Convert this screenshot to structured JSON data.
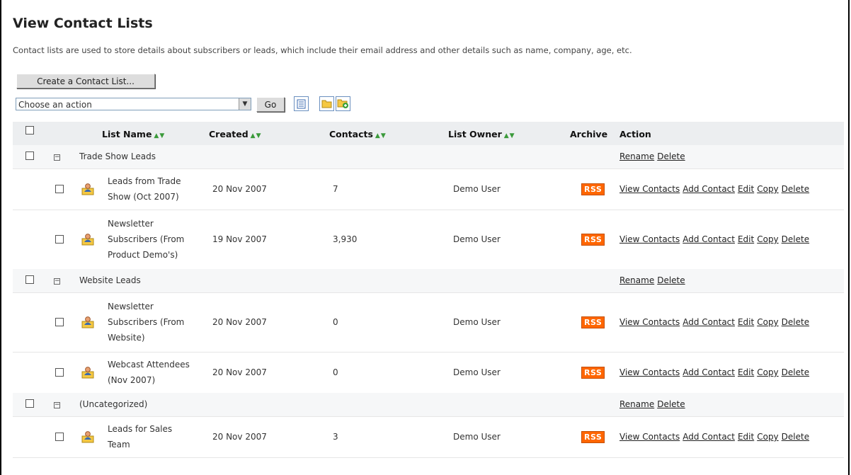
{
  "page": {
    "title": "View Contact Lists",
    "description": "Contact lists are used to store details about subscribers or leads, which include their email address and other details such as name, company, age, etc."
  },
  "toolbar": {
    "create_label": "Create a Contact List...",
    "action_select_value": "Choose an action",
    "go_label": "Go"
  },
  "columns": {
    "list_name": "List Name",
    "created": "Created",
    "contacts": "Contacts",
    "list_owner": "List Owner",
    "archive": "Archive",
    "action": "Action"
  },
  "group_actions": {
    "rename": "Rename",
    "delete": "Delete"
  },
  "row_actions": {
    "view": "View Contacts",
    "add": "Add Contact",
    "edit": "Edit",
    "copy": "Copy",
    "delete": "Delete"
  },
  "rss_label": "RSS",
  "groups": [
    {
      "name": "Trade Show Leads",
      "lists": [
        {
          "name_lines": [
            "Leads from Trade",
            "Show (Oct 2007)"
          ],
          "created": "20 Nov 2007",
          "contacts": "7",
          "owner": "Demo User"
        },
        {
          "name_lines": [
            "Newsletter",
            "Subscribers (From",
            "Product Demo's)"
          ],
          "created": "19 Nov 2007",
          "contacts": "3,930",
          "owner": "Demo User"
        }
      ]
    },
    {
      "name": "Website Leads",
      "lists": [
        {
          "name_lines": [
            "Newsletter",
            "Subscribers (From",
            "Website)"
          ],
          "created": "20 Nov 2007",
          "contacts": "0",
          "owner": "Demo User"
        },
        {
          "name_lines": [
            "Webcast Attendees",
            "(Nov 2007)"
          ],
          "created": "20 Nov 2007",
          "contacts": "0",
          "owner": "Demo User"
        }
      ]
    },
    {
      "name": "(Uncategorized)",
      "lists": [
        {
          "name_lines": [
            "Leads for Sales",
            "Team"
          ],
          "created": "20 Nov 2007",
          "contacts": "3",
          "owner": "Demo User"
        }
      ]
    }
  ]
}
